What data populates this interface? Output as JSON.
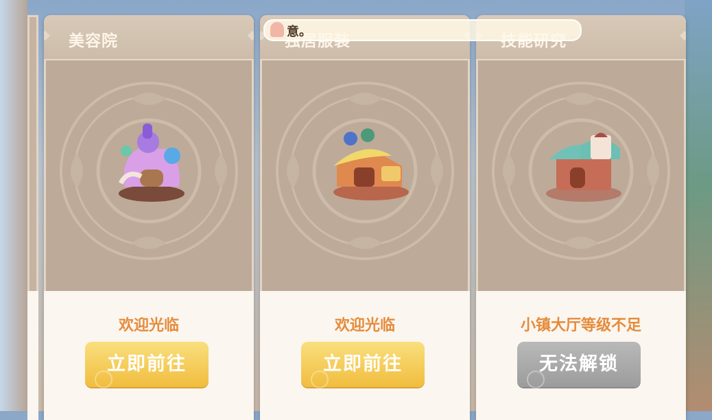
{
  "notice": {
    "text": "意。"
  },
  "cards": [
    {
      "title": "美容院",
      "status": "欢迎光临",
      "button": "立即前往",
      "button_state": "active",
      "building": "beauty-salon-building"
    },
    {
      "title": "独居服装",
      "status": "欢迎光临",
      "button": "立即前往",
      "button_state": "active",
      "building": "clothing-shop-building"
    },
    {
      "title": "技能研究",
      "status": "小镇大厅等级不足",
      "button": "无法解锁",
      "button_state": "locked",
      "building": "skill-research-building"
    }
  ],
  "colors": {
    "card_body": "#bdaa99",
    "card_footer": "#fbf6ef",
    "status_text": "#e58b3b",
    "button_active": "#f1bd3e",
    "button_locked": "#9c9c9c"
  }
}
